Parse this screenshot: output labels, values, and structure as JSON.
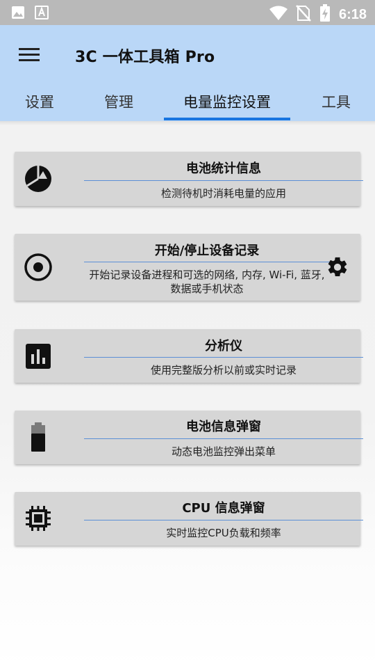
{
  "status_bar": {
    "time": "6:18",
    "icons": [
      "image-icon",
      "font-icon",
      "wifi-icon",
      "no-sim-icon",
      "battery-charging-icon"
    ]
  },
  "app_bar": {
    "title": "3C 一体工具箱 Pro",
    "menu_icon": "menu-icon"
  },
  "tabs": [
    {
      "label": "设置",
      "active": false
    },
    {
      "label": "管理",
      "active": false
    },
    {
      "label": "电量监控设置",
      "active": true
    },
    {
      "label": "工具",
      "active": false
    }
  ],
  "cards": [
    {
      "title": "电池统计信息",
      "description": "检测待机时消耗电量的应用",
      "icon": "pie-chart-icon"
    },
    {
      "title": "开始/停止设备记录",
      "description_line1": "开始记录设备进程和可选的网络, 内存, Wi-Fi, 蓝牙,",
      "description_line2": "数据或手机状态",
      "icon": "record-icon",
      "settings_icon": "gear-icon"
    },
    {
      "title": "分析仪",
      "description": "使用完整版分析以前或实时记录",
      "icon": "bar-chart-icon"
    },
    {
      "title": "电池信息弹窗",
      "description": "动态电池监控弹出菜单",
      "icon": "battery-icon"
    },
    {
      "title": "CPU 信息弹窗",
      "description": "实时监控CPU负载和频率",
      "icon": "cpu-chip-icon"
    }
  ],
  "colors": {
    "app_bar": "#bad7f7",
    "tab_indicator": "#1875e0",
    "card_bg": "#d6d6d6",
    "divider": "#5b8fd6"
  }
}
